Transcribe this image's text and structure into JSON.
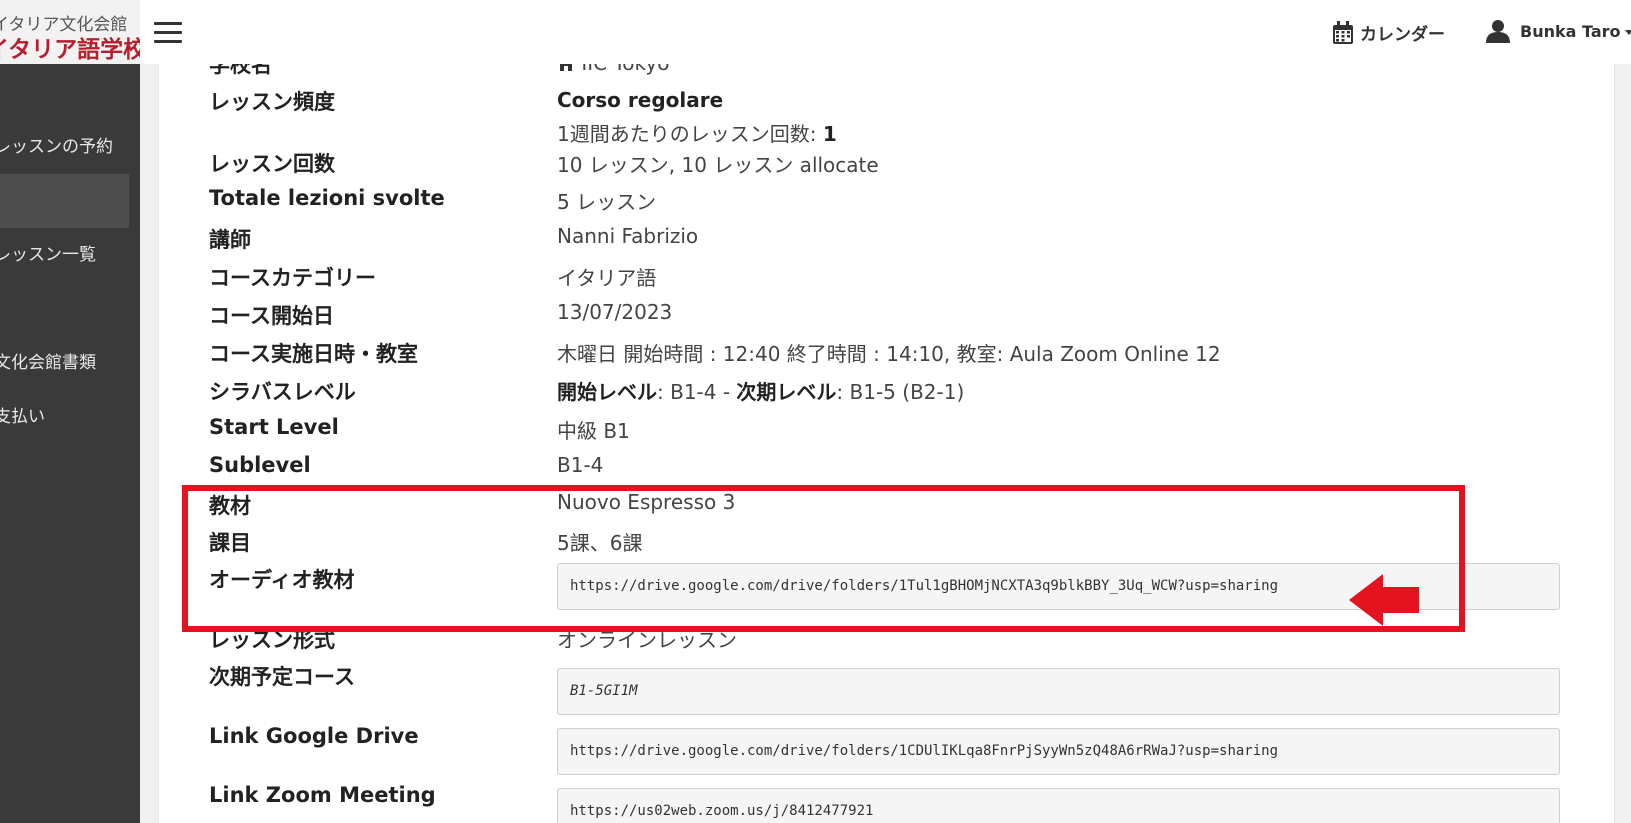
{
  "logo": {
    "line1": "イタリア文化会館",
    "line2": "イタリア語学校"
  },
  "sidebar": {
    "items": [
      {
        "label": "レッスンの予約"
      },
      {
        "label": ""
      },
      {
        "label": "レッスン一覧"
      },
      {
        "label": "文化会館書類"
      },
      {
        "label": "支払い"
      }
    ]
  },
  "topbar": {
    "calendar_label": "カレンダー",
    "user_name": "Bunka Taro"
  },
  "details": {
    "school_label": "学校名",
    "school_value": "IIC Tokyo",
    "frequency_label": "レッスン頻度",
    "frequency_value": "Corso regolare",
    "frequency_per_week_label": "1週間あたりのレッスン回数: ",
    "frequency_per_week_value": "1",
    "lesson_count_label": "レッスン回数",
    "lesson_count_value": "10 レッスン, 10 レッスン allocate",
    "total_label": "Totale lezioni svolte",
    "total_value": "5 レッスン",
    "teacher_label": "講師",
    "teacher_value": "Nanni Fabrizio",
    "category_label": "コースカテゴリー",
    "category_value": "イタリア語",
    "start_date_label": "コース開始日",
    "start_date_value": "13/07/2023",
    "schedule_label": "コース実施日時・教室",
    "schedule_value": "木曜日 開始時間 : 12:40 終了時間 : 14:10, 教室: Aula Zoom Online 12",
    "syllabus_label": "シラバスレベル",
    "syllabus_start_label": "開始レベル",
    "syllabus_start_value": ": B1-4",
    "syllabus_sep": " - ",
    "syllabus_next_label": "次期レベル",
    "syllabus_next_value": ": B1-5 (B2-1)",
    "start_level_label": "Start Level",
    "start_level_value": "中級 B1",
    "sublevel_label": "Sublevel",
    "sublevel_value": "B1-4",
    "textbook_label": "教材",
    "textbook_value": "Nuovo Espresso 3",
    "subject_label": "課目",
    "subject_value": "5課、6課",
    "audio_label": "オーディオ教材",
    "audio_value": "https://drive.google.com/drive/folders/1Tul1gBHOMjNCXTA3q9blkBBY_3Uq_WCW?usp=sharing",
    "format_label": "レッスン形式",
    "format_value": "オンラインレッスン",
    "next_course_label": "次期予定コース",
    "next_course_value": "B1-5GI1M",
    "gdrive_label": "Link Google Drive",
    "gdrive_value": "https://drive.google.com/drive/folders/1CDUlIKLqa8FnrPjSyyWn5zQ48A6rRWaJ?usp=sharing",
    "zoom_label": "Link Zoom Meeting",
    "zoom_value": "https://us02web.zoom.us/j/8412477921"
  },
  "colors": {
    "sidebar_bg": "#3a3a3a",
    "brand_red": "#b51f2e",
    "highlight_red": "#e3131f"
  }
}
